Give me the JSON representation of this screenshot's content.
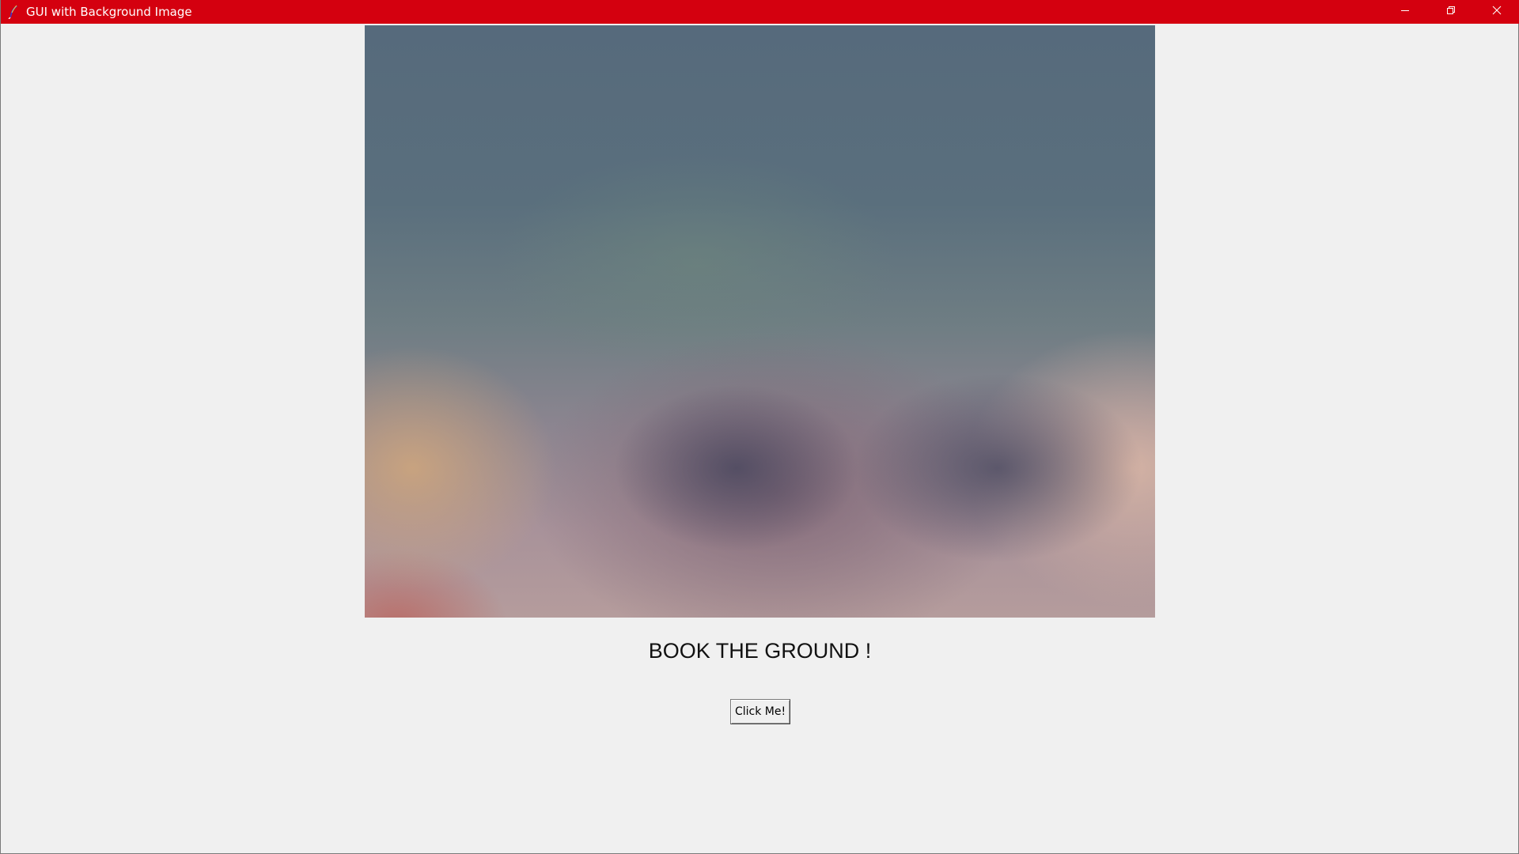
{
  "window": {
    "title": "GUI with Background Image",
    "titlebar_color": "#d4000f",
    "app_icon": "feather-icon",
    "controls": {
      "minimize_icon": "minimize-icon",
      "restore_icon": "restore-icon",
      "close_icon": "close-icon"
    }
  },
  "content": {
    "background_image": "cloudy-sky-image",
    "caption": "BOOK THE GROUND !",
    "button_label": "Click Me!"
  }
}
